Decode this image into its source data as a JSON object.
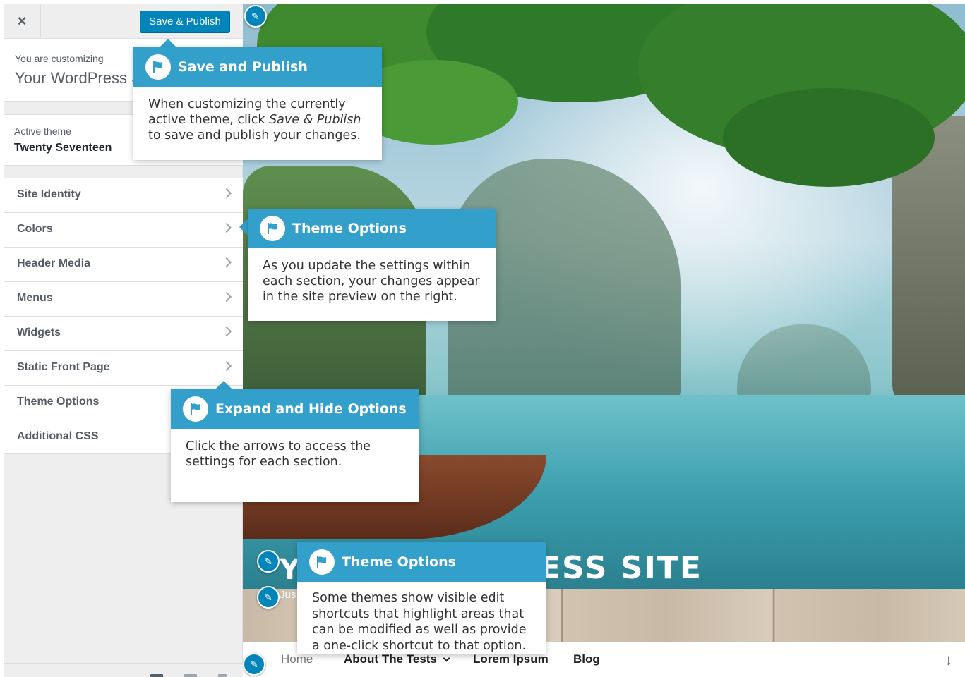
{
  "header": {
    "close_label": "×",
    "save_label": "Save & Publish"
  },
  "info": {
    "label": "You are customizing",
    "title": "Your WordPress Site"
  },
  "theme": {
    "label": "Active theme",
    "name": "Twenty Seventeen"
  },
  "sections": [
    {
      "label": "Site Identity"
    },
    {
      "label": "Colors"
    },
    {
      "label": "Header Media"
    },
    {
      "label": "Menus"
    },
    {
      "label": "Widgets"
    },
    {
      "label": "Static Front Page"
    },
    {
      "label": "Theme Options"
    },
    {
      "label": "Additional CSS"
    }
  ],
  "preview": {
    "site_title_visible": "ESS SITE",
    "title_fragment": "Y",
    "tagline_fragment": "Jus",
    "nav": {
      "home": "Home",
      "about": "About The Tests",
      "lorem": "Lorem Ipsum",
      "blog": "Blog",
      "arrow": "↓"
    }
  },
  "pointers": {
    "save": {
      "title": "Save and Publish",
      "body_pre": "When customizing the currently active theme, click ",
      "body_em": "Save & Publish",
      "body_post": " to save and publish your changes."
    },
    "theme_options_1": {
      "title": "Theme Options",
      "body": "As you update the settings within each section, your changes appear in the site preview on the right."
    },
    "expand": {
      "title": "Expand and Hide Options",
      "body": "Click the arrows to access the settings for each section."
    },
    "theme_options_2": {
      "title": "Theme Options",
      "body": "Some themes show visible edit shortcuts that highlight areas that can be modified as well as provide a one-click shortcut to that option."
    }
  },
  "colors": {
    "primary_button": "#0085ba",
    "pointer_header": "#33a0cc",
    "sidebar_bg": "#eeeeee"
  },
  "icons": {
    "close": "close-icon",
    "chevron": "chevron-right-icon",
    "pencil": "pencil-icon",
    "flag": "flag-icon",
    "scroll": "arrow-down-icon"
  }
}
